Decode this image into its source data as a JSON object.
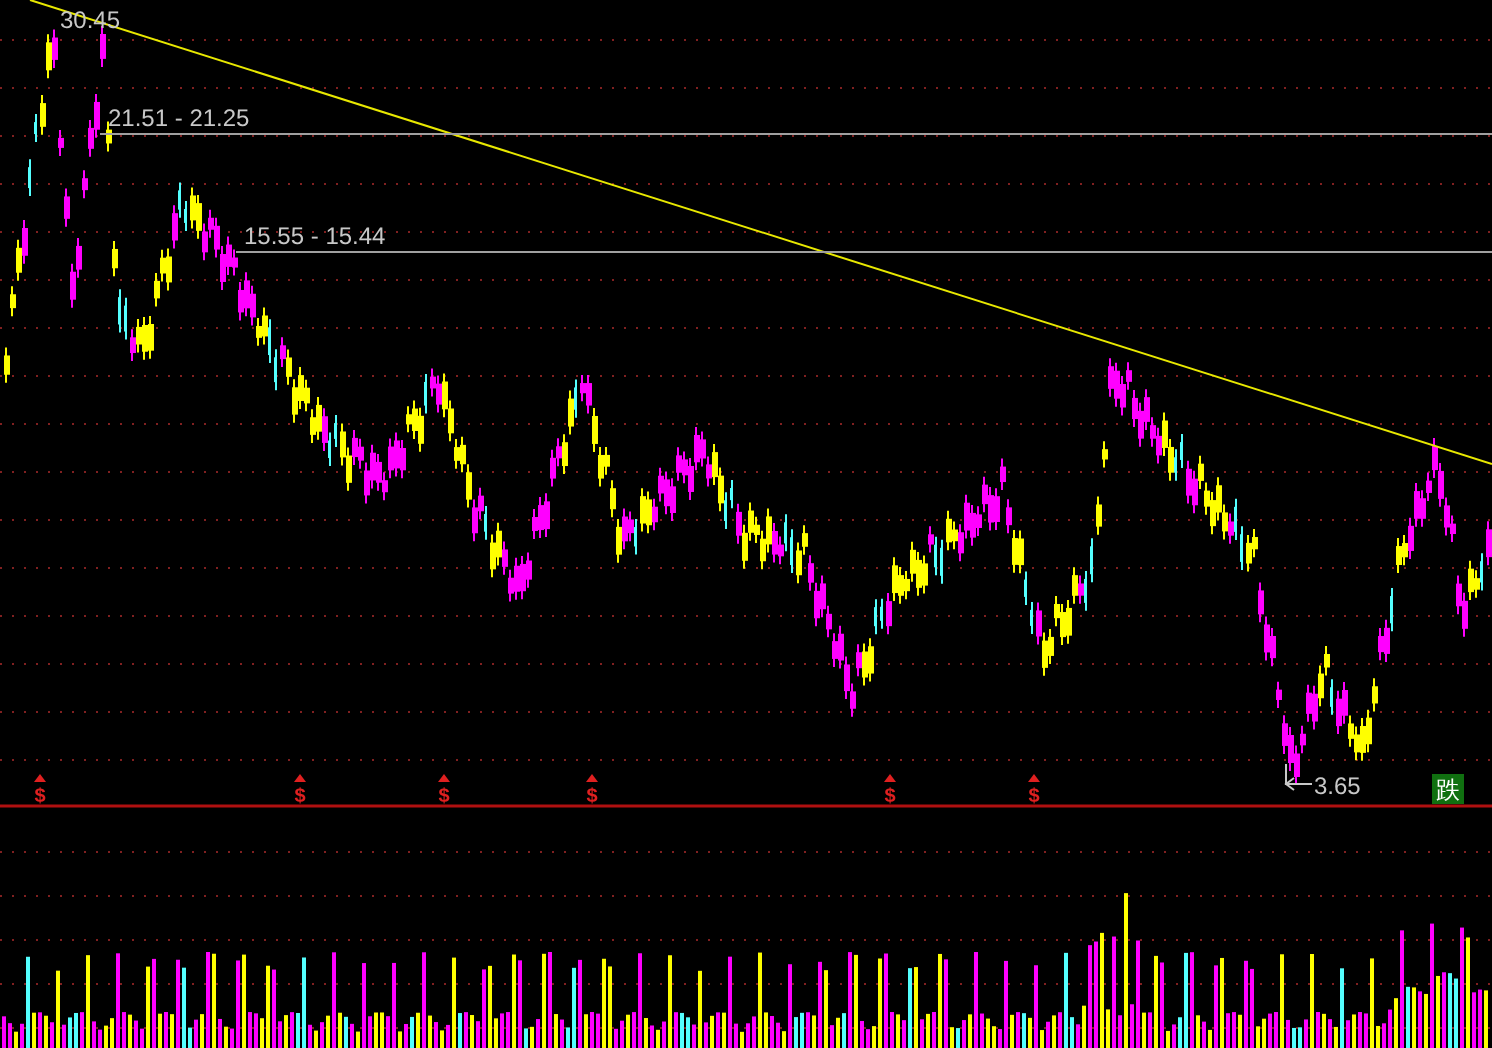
{
  "price_labels": [
    {
      "kind": "high",
      "text": "30.45"
    },
    {
      "kind": "level",
      "text": "21.51 - 21.25"
    },
    {
      "kind": "level",
      "text": "15.55 - 15.44"
    },
    {
      "kind": "low",
      "text": "3.65"
    }
  ],
  "signals": [
    {
      "kind": "buy",
      "label": "$"
    },
    {
      "kind": "buy",
      "label": "$"
    },
    {
      "kind": "buy",
      "label": "$"
    },
    {
      "kind": "buy",
      "label": "$"
    },
    {
      "kind": "buy",
      "label": "$"
    },
    {
      "kind": "buy",
      "label": "$"
    },
    {
      "kind": "sell",
      "label": "跌"
    }
  ]
}
